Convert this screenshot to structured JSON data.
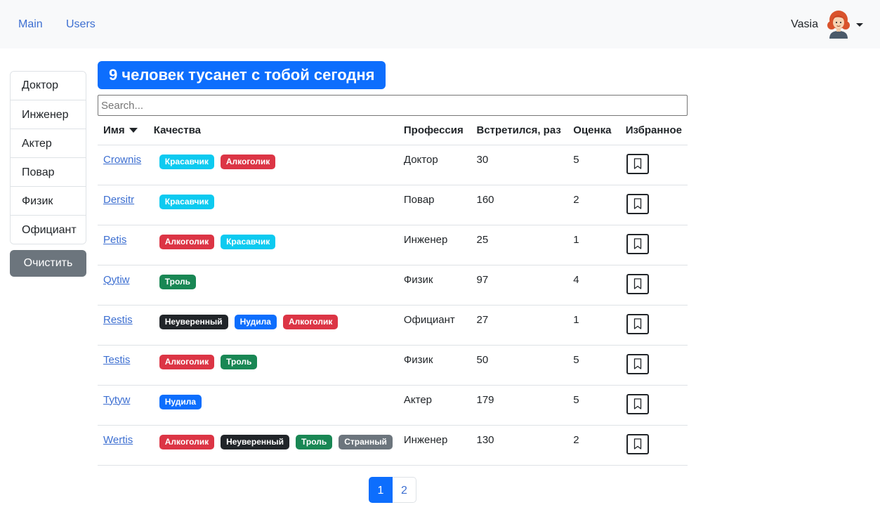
{
  "nav": {
    "main_label": "Main",
    "users_label": "Users",
    "user_name": "Vasia",
    "avatar_icon": "user-avatar-icon"
  },
  "sidebar": {
    "professions": [
      "Доктор",
      "Инженер",
      "Актер",
      "Повар",
      "Физик",
      "Официант"
    ],
    "clear_label": "Очистить"
  },
  "title": "9 человек тусанет с тобой сегодня",
  "search": {
    "placeholder": "Search...",
    "value": ""
  },
  "table": {
    "headers": {
      "name": "Имя",
      "qualities": "Качества",
      "profession": "Профессия",
      "met": "Встретился, раз",
      "rate": "Оценка",
      "favorite": "Избранное"
    },
    "sort_icon": "sort-down-icon",
    "bookmark_icon": "bookmark-icon",
    "rows": [
      {
        "name": "Crownis",
        "qualities": [
          {
            "label": "Красавчик",
            "color": "#0dcaf0"
          },
          {
            "label": "Алкоголик",
            "color": "#dc3545"
          }
        ],
        "profession": "Доктор",
        "met": "30",
        "rate": "5"
      },
      {
        "name": "Dersitr",
        "qualities": [
          {
            "label": "Красавчик",
            "color": "#0dcaf0"
          }
        ],
        "profession": "Повар",
        "met": "160",
        "rate": "2"
      },
      {
        "name": "Petis",
        "qualities": [
          {
            "label": "Алкоголик",
            "color": "#dc3545"
          },
          {
            "label": "Красавчик",
            "color": "#0dcaf0"
          }
        ],
        "profession": "Инженер",
        "met": "25",
        "rate": "1"
      },
      {
        "name": "Qytiw",
        "qualities": [
          {
            "label": "Троль",
            "color": "#198754"
          }
        ],
        "profession": "Физик",
        "met": "97",
        "rate": "4"
      },
      {
        "name": "Restis",
        "qualities": [
          {
            "label": "Неуверенный",
            "color": "#212529"
          },
          {
            "label": "Нудила",
            "color": "#0d6efd"
          },
          {
            "label": "Алкоголик",
            "color": "#dc3545"
          }
        ],
        "profession": "Официант",
        "met": "27",
        "rate": "1"
      },
      {
        "name": "Testis",
        "qualities": [
          {
            "label": "Алкоголик",
            "color": "#dc3545"
          },
          {
            "label": "Троль",
            "color": "#198754"
          }
        ],
        "profession": "Физик",
        "met": "50",
        "rate": "5"
      },
      {
        "name": "Tytyw",
        "qualities": [
          {
            "label": "Нудила",
            "color": "#0d6efd"
          }
        ],
        "profession": "Актер",
        "met": "179",
        "rate": "5"
      },
      {
        "name": "Wertis",
        "qualities": [
          {
            "label": "Алкоголик",
            "color": "#dc3545"
          },
          {
            "label": "Неуверенный",
            "color": "#212529"
          },
          {
            "label": "Троль",
            "color": "#198754"
          },
          {
            "label": "Странный",
            "color": "#6c757d"
          }
        ],
        "profession": "Инженер",
        "met": "130",
        "rate": "2"
      }
    ]
  },
  "pagination": {
    "pages": [
      "1",
      "2"
    ],
    "current": "1"
  }
}
